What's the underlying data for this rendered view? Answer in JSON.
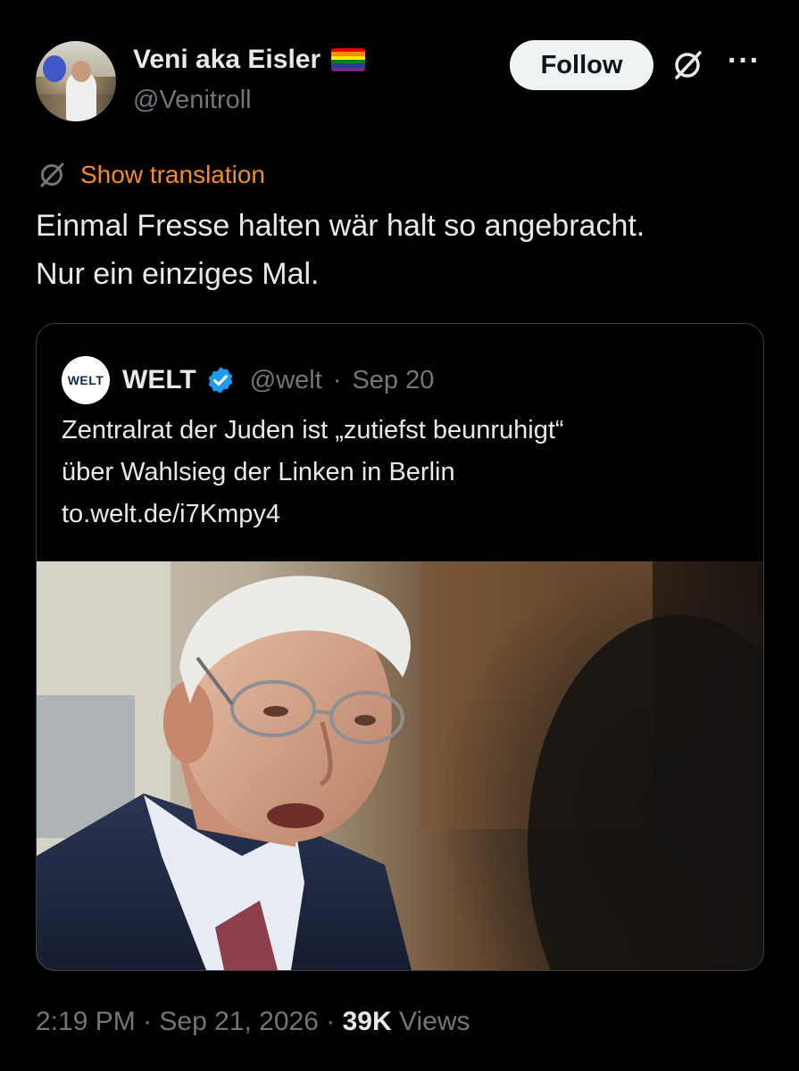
{
  "author": {
    "display_name": "Veni aka Eisler",
    "handle": "@Venitroll",
    "avatar_icon": "profile-photo",
    "flag_icon": "rainbow-flag-icon"
  },
  "actions": {
    "follow_label": "Follow",
    "grok_icon": "grok-icon",
    "more_icon": "more-icon"
  },
  "translation": {
    "link_label": "Show translation",
    "accent_color": "#f28c28"
  },
  "tweet": {
    "lines": [
      "Einmal Fresse halten wär halt so angebracht.",
      "Nur ein einziges Mal."
    ]
  },
  "quoted": {
    "logo_text": "WELT",
    "name": "WELT",
    "verified_icon": "verified-badge-icon",
    "handle": "@welt",
    "separator": "·",
    "date": "Sep 20",
    "lines": [
      "Zentralrat der Juden ist „zutiefst beunruhigt“",
      "über Wahlsieg der Linken in Berlin",
      "to.welt.de/i7Kmpy4"
    ],
    "image_description_icon": "news-photo"
  },
  "footer": {
    "time": "2:19 PM",
    "separator": "·",
    "date": "Sep 21, 2026",
    "views_count": "39K",
    "views_label": "Views"
  }
}
